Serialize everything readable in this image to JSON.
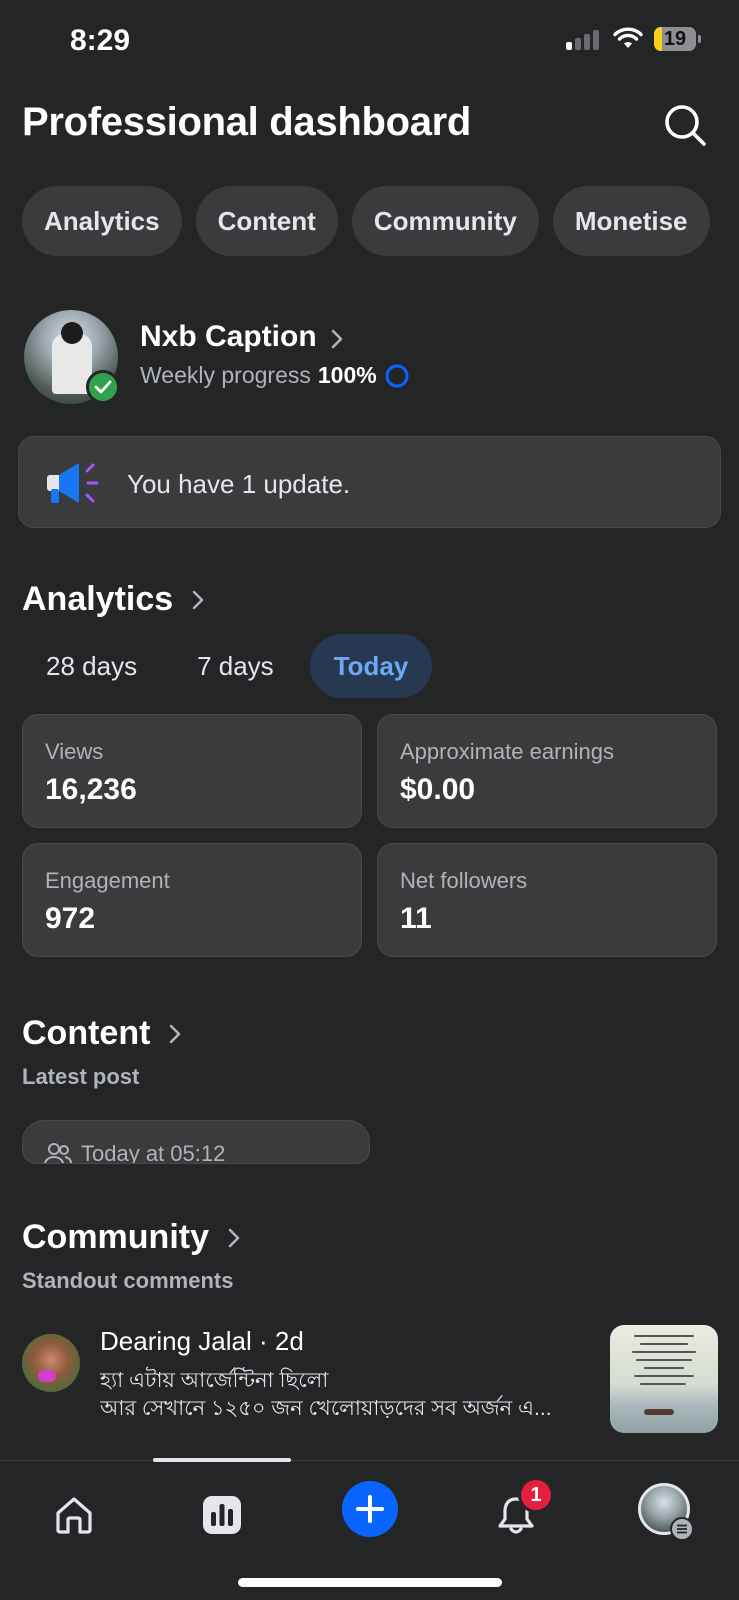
{
  "status_bar": {
    "time": "8:29",
    "battery": "19",
    "battery_level": 0.19
  },
  "header": {
    "title": "Professional dashboard",
    "search_icon": "search-icon"
  },
  "tabs": [
    {
      "label": "Analytics"
    },
    {
      "label": "Content"
    },
    {
      "label": "Community"
    },
    {
      "label": "Monetise"
    }
  ],
  "profile": {
    "name": "Nxb Caption",
    "progress_label": "Weekly progress",
    "progress_value": "100%"
  },
  "update": {
    "text": "You have 1 update."
  },
  "analytics": {
    "title": "Analytics",
    "ranges": [
      {
        "label": "28 days"
      },
      {
        "label": "7 days"
      },
      {
        "label": "Today"
      }
    ],
    "active_range": "Today",
    "stats": [
      {
        "label": "Views",
        "value": "16,236"
      },
      {
        "label": "Approximate earnings",
        "value": "$0.00"
      },
      {
        "label": "Engagement",
        "value": "972"
      },
      {
        "label": "Net followers",
        "value": "11"
      }
    ]
  },
  "content": {
    "title": "Content",
    "subtitle": "Latest post",
    "post_time": "Today at 05:12"
  },
  "community": {
    "title": "Community",
    "subtitle": "Standout comments",
    "comment": {
      "author": "Dearing Jalal · 2d",
      "line1": "হ্যা এটায় আর্জেন্টিনা ছিলো",
      "line2": "আর সেখানে ১২৫০ জন খেলোয়াড়দের সব অর্জন এ..."
    }
  },
  "bottom_nav": {
    "items": [
      "home-icon",
      "dashboard-icon",
      "create-icon",
      "notifications-icon",
      "profile-icon"
    ],
    "notification_count": "1"
  },
  "colors": {
    "background": "#242527",
    "card": "#3a3b3c",
    "accent": "#0866ff",
    "active_tab_text": "#6ca8f5",
    "verified": "#31a24c",
    "badge": "#e41e3f"
  }
}
